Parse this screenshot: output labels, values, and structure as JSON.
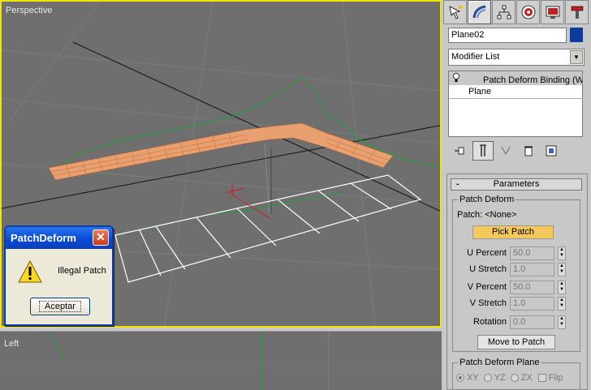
{
  "viewports": {
    "perspective_label": "Perspective",
    "left_label": "Left"
  },
  "dialog": {
    "title": "PatchDeform",
    "message": "Illegal Patch",
    "ok_label": "Aceptar",
    "close_glyph": "✕"
  },
  "panel": {
    "tabs": [
      {
        "icon": "create-icon"
      },
      {
        "icon": "modify-icon"
      },
      {
        "icon": "hierarchy-icon"
      },
      {
        "icon": "motion-icon"
      },
      {
        "icon": "display-icon"
      },
      {
        "icon": "utilities-icon"
      }
    ],
    "object_name": "Plane02",
    "object_color": "#0c3c9c",
    "modifier_list": "Modifier List",
    "stack": {
      "selected": "Patch Deform Binding (W",
      "base": "Plane"
    },
    "parameters": {
      "rollout_title": "Parameters",
      "minus": "-",
      "patch_deform_group": "Patch Deform",
      "patch_label": "Patch: <None>",
      "pick_patch": "Pick Patch",
      "u_percent_label": "U Percent",
      "u_percent_value": "50.0",
      "u_stretch_label": "U Stretch",
      "u_stretch_value": "1.0",
      "v_percent_label": "V Percent",
      "v_percent_value": "50.0",
      "v_stretch_label": "V Stretch",
      "v_stretch_value": "1.0",
      "rotation_label": "Rotation",
      "rotation_value": "0.0",
      "move_to_patch": "Move to Patch",
      "plane_group": "Patch Deform Plane",
      "xy": "XY",
      "yz": "YZ",
      "zx": "ZX",
      "flip": "Flip"
    }
  },
  "colors": {
    "viewport_bg": "#6f6f6f",
    "active_border": "#f0e400",
    "patch_orange": "#e8a070",
    "spline_green": "#1ea03a",
    "pick_button": "#f4c85a"
  }
}
